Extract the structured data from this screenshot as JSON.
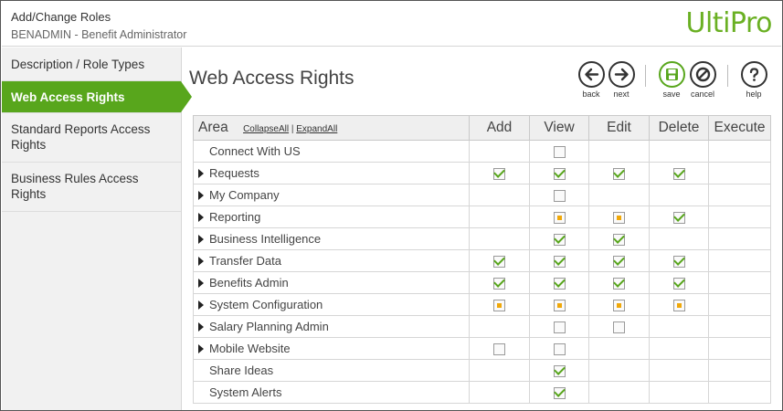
{
  "header": {
    "title": "Add/Change Roles",
    "subtitle": "BENADMIN - Benefit Administrator",
    "logo": "UltiPro"
  },
  "sidebar": {
    "items": [
      {
        "label": "Description / Role Types",
        "active": false
      },
      {
        "label": "Web Access Rights",
        "active": true
      },
      {
        "label": "Standard Reports Access Rights",
        "active": false
      },
      {
        "label": "Business Rules Access Rights",
        "active": false
      }
    ]
  },
  "main": {
    "title": "Web Access Rights"
  },
  "toolbar": {
    "back": {
      "label": "back",
      "icon": "arrow-left-icon"
    },
    "next": {
      "label": "next",
      "icon": "arrow-right-icon"
    },
    "save": {
      "label": "save",
      "icon": "save-disk-icon"
    },
    "cancel": {
      "label": "cancel",
      "icon": "cancel-circle-icon"
    },
    "help": {
      "label": "help",
      "icon": "help-question-icon"
    }
  },
  "grid": {
    "columns": {
      "area": "Area",
      "collapse_all": "CollapseAll",
      "separator": "|",
      "expand_all": "ExpandAll",
      "add": "Add",
      "view": "View",
      "edit": "Edit",
      "delete": "Delete",
      "execute": "Execute"
    },
    "rows": [
      {
        "name": "Connect With US",
        "expandable": false,
        "add": null,
        "view": "unchecked",
        "edit": null,
        "delete": null,
        "execute": null
      },
      {
        "name": "Requests",
        "expandable": true,
        "add": "checked",
        "view": "checked",
        "edit": "checked",
        "delete": "checked",
        "execute": null
      },
      {
        "name": "My Company",
        "expandable": true,
        "add": null,
        "view": "unchecked",
        "edit": null,
        "delete": null,
        "execute": null
      },
      {
        "name": "Reporting",
        "expandable": true,
        "add": null,
        "view": "partial",
        "edit": "partial",
        "delete": "checked",
        "execute": null
      },
      {
        "name": "Business Intelligence",
        "expandable": true,
        "add": null,
        "view": "checked",
        "edit": "checked",
        "delete": null,
        "execute": null
      },
      {
        "name": "Transfer Data",
        "expandable": true,
        "add": "checked",
        "view": "checked",
        "edit": "checked",
        "delete": "checked",
        "execute": null
      },
      {
        "name": "Benefits Admin",
        "expandable": true,
        "add": "checked",
        "view": "checked",
        "edit": "checked",
        "delete": "checked",
        "execute": null
      },
      {
        "name": "System Configuration",
        "expandable": true,
        "add": "partial",
        "view": "partial",
        "edit": "partial",
        "delete": "partial",
        "execute": null
      },
      {
        "name": "Salary Planning Admin",
        "expandable": true,
        "add": null,
        "view": "unchecked",
        "edit": "unchecked",
        "delete": null,
        "execute": null
      },
      {
        "name": "Mobile Website",
        "expandable": true,
        "add": "unchecked",
        "view": "unchecked",
        "edit": null,
        "delete": null,
        "execute": null
      },
      {
        "name": "Share Ideas",
        "expandable": false,
        "add": null,
        "view": "checked",
        "edit": null,
        "delete": null,
        "execute": null
      },
      {
        "name": "System Alerts",
        "expandable": false,
        "add": null,
        "view": "checked",
        "edit": null,
        "delete": null,
        "execute": null
      }
    ]
  },
  "colors": {
    "brand_green": "#58a61c",
    "logo_green": "#6ab023",
    "partial_orange": "#f0a80a"
  }
}
